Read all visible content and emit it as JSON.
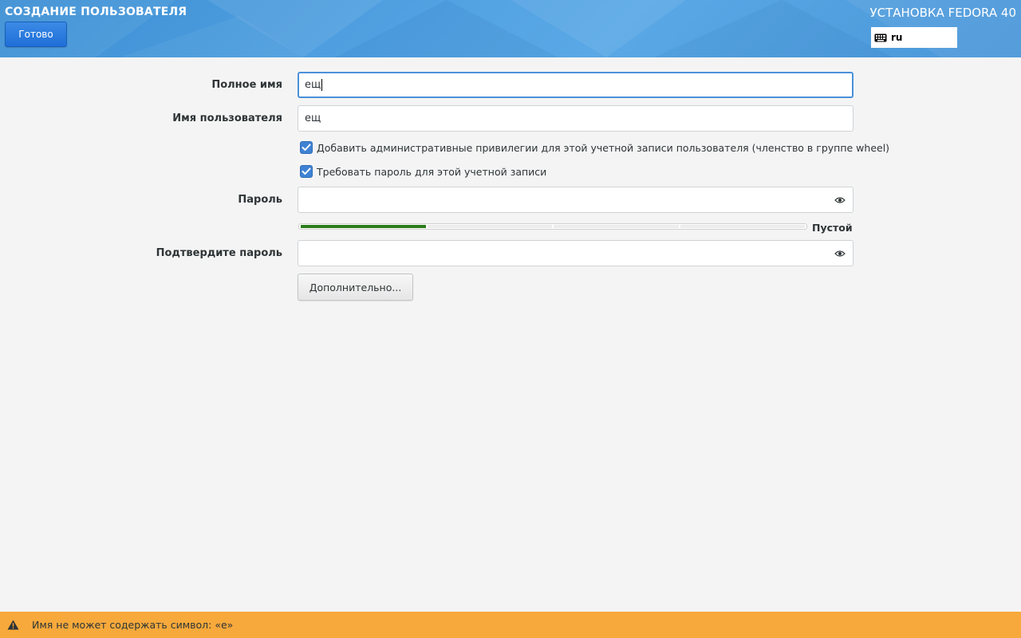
{
  "header": {
    "title": "СОЗДАНИЕ ПОЛЬЗОВАТЕЛЯ",
    "done_label": "Готово",
    "product": "УСТАНОВКА FEDORA 40",
    "keyboard_layout": "ru"
  },
  "form": {
    "full_name": {
      "label": "Полное имя",
      "value": "ещ"
    },
    "username": {
      "label": "Имя пользователя",
      "value": "ещ"
    },
    "admin_checkbox": {
      "label": "Добавить административные привилегии для этой учетной записи пользователя (членство в группе wheel)",
      "checked": true
    },
    "require_password_checkbox": {
      "label": "Требовать пароль для этой учетной записи",
      "checked": true
    },
    "password": {
      "label": "Пароль",
      "value": ""
    },
    "strength": {
      "label": "Пустой",
      "level": 0.25
    },
    "confirm_password": {
      "label": "Подтвердите пароль",
      "value": ""
    },
    "advanced_label": "Дополнительно..."
  },
  "warning": {
    "text": "Имя не может содержать символ: «е»"
  },
  "colors": {
    "header_blue": "#4f9fe0",
    "button_blue": "#1f6fd8",
    "warning": "#f7a93b",
    "strength_fill": "#2a7d1a",
    "focus": "#4a90d9"
  },
  "icons": {
    "keyboard": "keyboard-icon",
    "reveal": "eye-icon",
    "warning": "warning-icon",
    "check": "checkmark-icon"
  }
}
